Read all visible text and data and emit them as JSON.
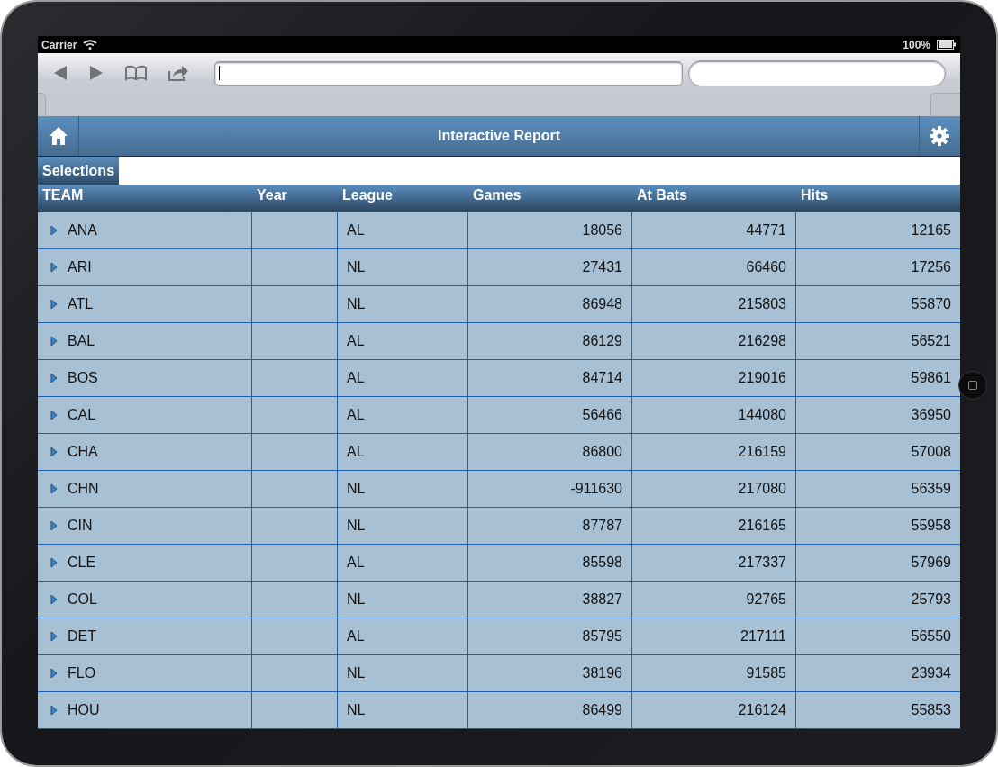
{
  "status_bar": {
    "carrier": "Carrier",
    "battery": "100%"
  },
  "header": {
    "title": "Interactive Report"
  },
  "selections": {
    "label": "Selections"
  },
  "table": {
    "columns": [
      {
        "label": "TEAM",
        "kind": "text"
      },
      {
        "label": "Year",
        "kind": "text"
      },
      {
        "label": "League",
        "kind": "text"
      },
      {
        "label": "Games",
        "kind": "number"
      },
      {
        "label": "At Bats",
        "kind": "number"
      },
      {
        "label": "Hits",
        "kind": "number"
      }
    ],
    "rows": [
      {
        "expanded": false,
        "cells": [
          "ANA",
          "",
          "AL",
          "18056",
          "44771",
          "12165"
        ]
      },
      {
        "expanded": false,
        "cells": [
          "ARI",
          "",
          "NL",
          "27431",
          "66460",
          "17256"
        ]
      },
      {
        "expanded": false,
        "cells": [
          "ATL",
          "",
          "NL",
          "86948",
          "215803",
          "55870"
        ]
      },
      {
        "expanded": false,
        "cells": [
          "BAL",
          "",
          "AL",
          "86129",
          "216298",
          "56521"
        ]
      },
      {
        "expanded": false,
        "cells": [
          "BOS",
          "",
          "AL",
          "84714",
          "219016",
          "59861"
        ]
      },
      {
        "expanded": false,
        "cells": [
          "CAL",
          "",
          "AL",
          "56466",
          "144080",
          "36950"
        ]
      },
      {
        "expanded": false,
        "cells": [
          "CHA",
          "",
          "AL",
          "86800",
          "216159",
          "57008"
        ]
      },
      {
        "expanded": false,
        "cells": [
          "CHN",
          "",
          "NL",
          "-911630",
          "217080",
          "56359"
        ]
      },
      {
        "expanded": false,
        "cells": [
          "CIN",
          "",
          "NL",
          "87787",
          "216165",
          "55958"
        ]
      },
      {
        "expanded": false,
        "cells": [
          "CLE",
          "",
          "AL",
          "85598",
          "217337",
          "57969"
        ]
      },
      {
        "expanded": false,
        "cells": [
          "COL",
          "",
          "NL",
          "38827",
          "92765",
          "25793"
        ]
      },
      {
        "expanded": false,
        "cells": [
          "DET",
          "",
          "AL",
          "85795",
          "217111",
          "56550"
        ]
      },
      {
        "expanded": false,
        "cells": [
          "FLO",
          "",
          "NL",
          "38196",
          "91585",
          "23934"
        ]
      },
      {
        "expanded": false,
        "cells": [
          "HOU",
          "",
          "NL",
          "86499",
          "216124",
          "55853"
        ]
      }
    ]
  }
}
